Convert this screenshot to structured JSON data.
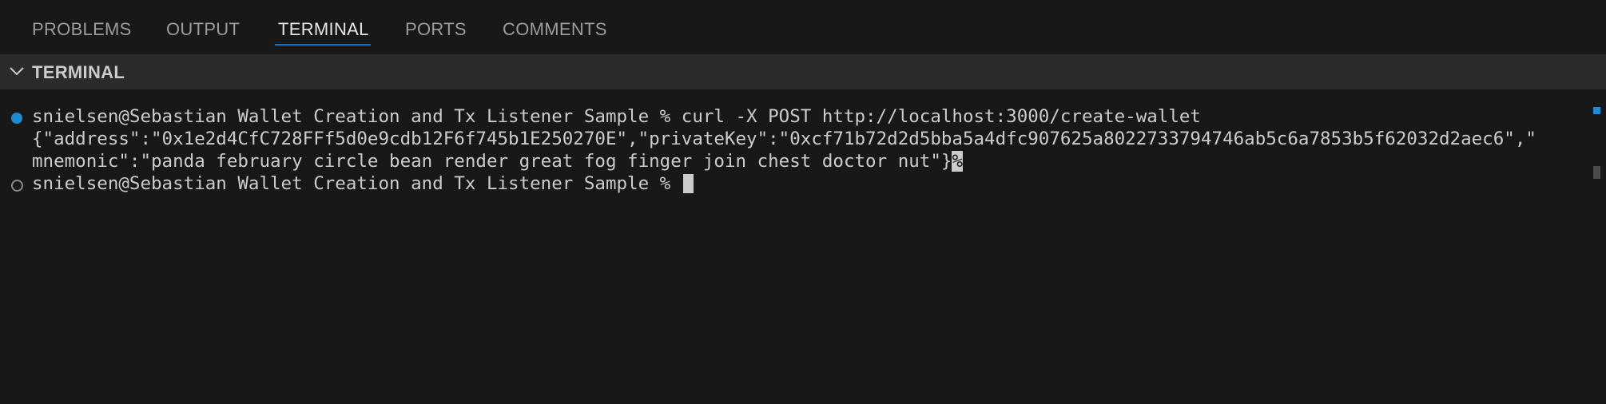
{
  "tabs": [
    {
      "label": "PROBLEMS",
      "active": false
    },
    {
      "label": "OUTPUT",
      "active": false
    },
    {
      "label": "TERMINAL",
      "active": true
    },
    {
      "label": "PORTS",
      "active": false
    },
    {
      "label": "COMMENTS",
      "active": false
    }
  ],
  "section": {
    "title": "TERMINAL",
    "icon": "chevron-down-icon"
  },
  "terminal": {
    "line1": "snielsen@Sebastian Wallet Creation and Tx Listener Sample % curl -X POST http://localhost:3000/create-wallet",
    "line2": "{\"address\":\"0x1e2d4CfC728FFf5d0e9cdb12F6f745b1E250270E\",\"privateKey\":\"0xcf71b72d2d5bba5a4dfc907625a8022733794746ab5c6a7853b5f62032d2aec6\",\"",
    "line3": "mnemonic\":\"panda february circle bean render great fog finger join chest doctor nut\"}",
    "line3_suffix": "%",
    "line4": "snielsen@Sebastian Wallet Creation and Tx Listener Sample % "
  },
  "colors": {
    "accent": "#0078d4",
    "status_dot": "#1f8ad2",
    "background": "#181818",
    "header_bg": "#2b2b2b"
  }
}
